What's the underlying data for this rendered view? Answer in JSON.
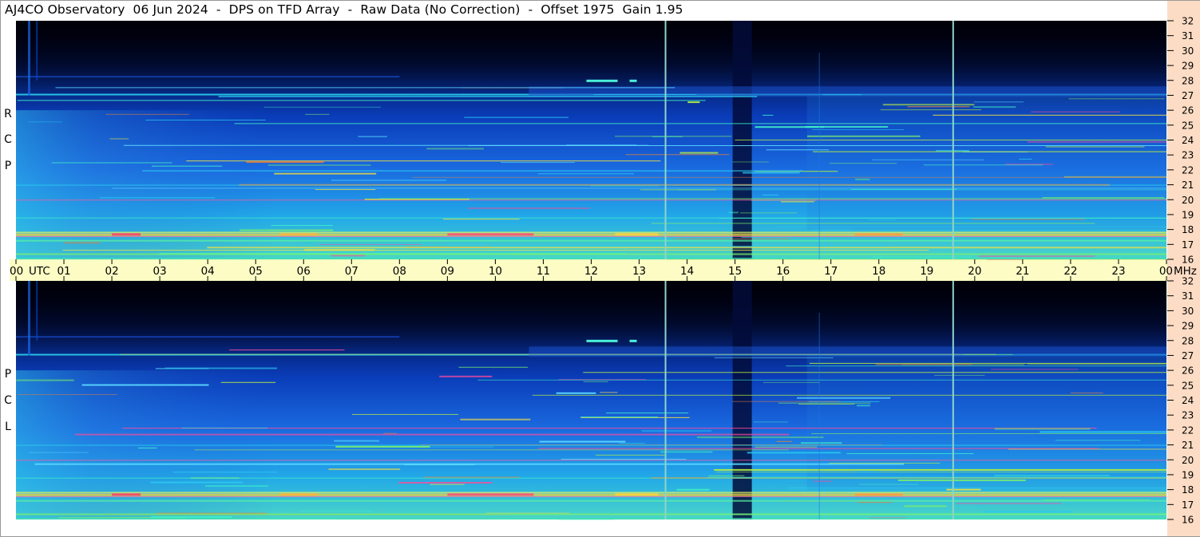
{
  "title": "AJ4CO Observatory  06 Jun 2024  -  DPS on TFD Array  -  Raw Data (No Correction)  -  Offset 1975  Gain 1.95",
  "colors": {
    "background": "#000000",
    "time_band": "#fcfcc4",
    "mhz_strip": "#fcdcc4",
    "marker_line": "#8fd4c8"
  },
  "chart_data": [
    {
      "type": "heatmap",
      "panel": "top",
      "ylabel": "R C P",
      "ylim": [
        16,
        32
      ],
      "yticks": [
        "16",
        "17",
        "18",
        "19",
        "20",
        "21",
        "22",
        "23",
        "24",
        "25",
        "26",
        "27",
        "28",
        "29",
        "30",
        "31",
        "32"
      ],
      "x_unit": "UTC",
      "xlim": [
        "00",
        "00"
      ],
      "xticks": [
        "00",
        "01",
        "02",
        "03",
        "04",
        "05",
        "06",
        "07",
        "08",
        "09",
        "10",
        "11",
        "12",
        "13",
        "14",
        "15",
        "16",
        "17",
        "18",
        "19",
        "20",
        "21",
        "22",
        "23",
        "00"
      ],
      "marker_times_utc": [
        13.55,
        19.55
      ]
    },
    {
      "type": "heatmap",
      "panel": "bottom",
      "ylabel": "L C P",
      "ylim": [
        16,
        32
      ],
      "yticks": [
        "16",
        "17",
        "18",
        "19",
        "20",
        "21",
        "22",
        "23",
        "24",
        "25",
        "26",
        "27",
        "28",
        "29",
        "30",
        "31",
        "32"
      ],
      "x_unit": "UTC",
      "xlim": [
        "00",
        "00"
      ],
      "xticks": [
        "00",
        "01",
        "02",
        "03",
        "04",
        "05",
        "06",
        "07",
        "08",
        "09",
        "10",
        "11",
        "12",
        "13",
        "14",
        "15",
        "16",
        "17",
        "18",
        "19",
        "20",
        "21",
        "22",
        "23",
        "00"
      ],
      "marker_times_utc": [
        13.55,
        19.55
      ]
    }
  ],
  "time_axis": {
    "labels": [
      "00",
      "01",
      "02",
      "03",
      "04",
      "05",
      "06",
      "07",
      "08",
      "09",
      "10",
      "11",
      "12",
      "13",
      "14",
      "15",
      "16",
      "17",
      "18",
      "19",
      "20",
      "21",
      "22",
      "23",
      "00"
    ],
    "utc_label": "UTC",
    "unit_label": "MHz"
  },
  "panels": [
    {
      "label": [
        "R",
        "C",
        "P"
      ]
    },
    {
      "label": [
        "L",
        "C",
        "P"
      ]
    }
  ],
  "freq_axis": {
    "labels": [
      "16",
      "17",
      "18",
      "19",
      "20",
      "21",
      "22",
      "23",
      "24",
      "25",
      "26",
      "27",
      "28",
      "29",
      "30",
      "31",
      "32"
    ]
  }
}
